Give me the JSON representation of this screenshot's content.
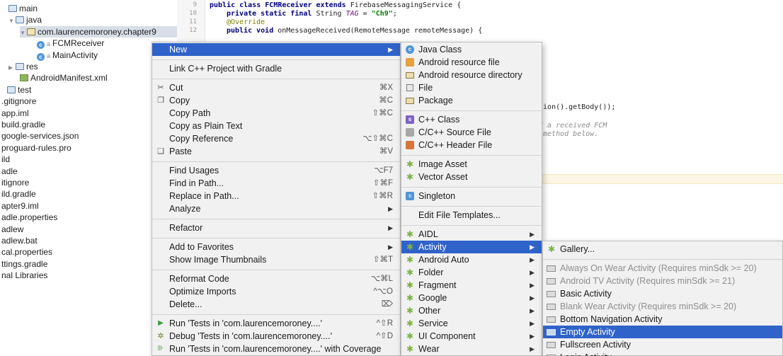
{
  "tree": {
    "items": [
      {
        "label": "main",
        "icon": "folder-icon",
        "indent": 12,
        "arrow": ""
      },
      {
        "label": "java",
        "icon": "folder-icon",
        "indent": 12,
        "arrow": "▼"
      },
      {
        "label": "com.laurencemoroney.chapter9",
        "icon": "package-icon",
        "indent": 28,
        "arrow": "▼",
        "selected": true
      },
      {
        "label": "FCMReceiver",
        "icon": "class-icon",
        "indent": 52,
        "arrow": ""
      },
      {
        "label": "MainActivity",
        "icon": "class-icon",
        "indent": 52,
        "arrow": ""
      },
      {
        "label": "res",
        "icon": "folder-icon",
        "indent": 12,
        "arrow": "▶"
      },
      {
        "label": "AndroidManifest.xml",
        "icon": "xml-icon",
        "indent": 28,
        "arrow": ""
      },
      {
        "label": "test",
        "icon": "folder-icon",
        "indent": 10,
        "arrow": ""
      },
      {
        "label": ".gitignore",
        "icon": "",
        "indent": 2,
        "arrow": ""
      },
      {
        "label": "app.iml",
        "icon": "",
        "indent": 2,
        "arrow": ""
      },
      {
        "label": "build.gradle",
        "icon": "",
        "indent": 2,
        "arrow": ""
      },
      {
        "label": "google-services.json",
        "icon": "",
        "indent": 2,
        "arrow": ""
      },
      {
        "label": "proguard-rules.pro",
        "icon": "",
        "indent": 2,
        "arrow": ""
      },
      {
        "label": "ild",
        "icon": "",
        "indent": 2,
        "arrow": ""
      },
      {
        "label": "adle",
        "icon": "",
        "indent": 2,
        "arrow": ""
      },
      {
        "label": "itignore",
        "icon": "",
        "indent": 2,
        "arrow": ""
      },
      {
        "label": "ild.gradle",
        "icon": "",
        "indent": 2,
        "arrow": ""
      },
      {
        "label": "apter9.iml",
        "icon": "",
        "indent": 2,
        "arrow": ""
      },
      {
        "label": "adle.properties",
        "icon": "",
        "indent": 2,
        "arrow": ""
      },
      {
        "label": "adlew",
        "icon": "",
        "indent": 2,
        "arrow": ""
      },
      {
        "label": "adlew.bat",
        "icon": "",
        "indent": 2,
        "arrow": ""
      },
      {
        "label": "cal.properties",
        "icon": "",
        "indent": 2,
        "arrow": ""
      },
      {
        "label": "ttings.gradle",
        "icon": "",
        "indent": 2,
        "arrow": ""
      },
      {
        "label": "nal Libraries",
        "icon": "",
        "indent": 2,
        "arrow": ""
      }
    ]
  },
  "editor": {
    "line_numbers": [
      "9",
      "10",
      "11",
      "12"
    ],
    "line1_kw": "public class ",
    "line1_name": "FCMReceiver ",
    "line1_kw2": "extends ",
    "line1_rest": "FirebaseMessagingService {",
    "line2_kw": "private static final ",
    "line2_type": "String ",
    "line2_var": "TAG",
    "line2_eq": " = ",
    "line2_str": "\"Ch9\"",
    "line2_end": ";",
    "line3": "@Override",
    "line4_kw": "public void ",
    "line4_rest": "onMessageReceived(RemoteMessage remoteMessage) {",
    "fragment1": "ation().getBody());",
    "fragment2": "of a received FCM",
    "fragment3": "n method below."
  },
  "menu1": {
    "items": [
      {
        "label": "New",
        "shortcut": "",
        "submenu": true,
        "active": true,
        "icon": ""
      },
      {
        "sep": true
      },
      {
        "label": "Link C++ Project with Gradle",
        "shortcut": "",
        "icon": ""
      },
      {
        "sep": true
      },
      {
        "label": "Cut",
        "shortcut": "⌘X",
        "icon": "scissors-icon"
      },
      {
        "label": "Copy",
        "shortcut": "⌘C",
        "icon": "copy-icon"
      },
      {
        "label": "Copy Path",
        "shortcut": "⇧⌘C",
        "icon": ""
      },
      {
        "label": "Copy as Plain Text",
        "shortcut": "",
        "icon": ""
      },
      {
        "label": "Copy Reference",
        "shortcut": "⌥⇧⌘C",
        "icon": ""
      },
      {
        "label": "Paste",
        "shortcut": "⌘V",
        "icon": "paste-icon"
      },
      {
        "sep": true
      },
      {
        "label": "Find Usages",
        "shortcut": "⌥F7",
        "icon": ""
      },
      {
        "label": "Find in Path...",
        "shortcut": "⇧⌘F",
        "icon": ""
      },
      {
        "label": "Replace in Path...",
        "shortcut": "⇧⌘R",
        "icon": ""
      },
      {
        "label": "Analyze",
        "shortcut": "",
        "submenu": true,
        "icon": ""
      },
      {
        "sep": true
      },
      {
        "label": "Refactor",
        "shortcut": "",
        "submenu": true,
        "icon": ""
      },
      {
        "sep": true
      },
      {
        "label": "Add to Favorites",
        "shortcut": "",
        "submenu": true,
        "icon": ""
      },
      {
        "label": "Show Image Thumbnails",
        "shortcut": "⇧⌘T",
        "icon": ""
      },
      {
        "sep": true
      },
      {
        "label": "Reformat Code",
        "shortcut": "⌥⌘L",
        "icon": ""
      },
      {
        "label": "Optimize Imports",
        "shortcut": "^⌥O",
        "icon": ""
      },
      {
        "label": "Delete...",
        "shortcut": "⌦",
        "icon": ""
      },
      {
        "sep": true
      },
      {
        "label": "Run 'Tests in 'com.laurencemoroney....'",
        "shortcut": "^⇧R",
        "icon": "run-icon"
      },
      {
        "label": "Debug 'Tests in 'com.laurencemoroney....'",
        "shortcut": "^⇧D",
        "icon": "debug-icon"
      },
      {
        "label": "Run 'Tests in 'com.laurencemoroney....' with Coverage",
        "shortcut": "",
        "icon": "coverage-icon"
      }
    ]
  },
  "menu2": {
    "items": [
      {
        "label": "Java Class",
        "icon": "java-class-icon"
      },
      {
        "label": "Android resource file",
        "icon": "android-resource-file-icon"
      },
      {
        "label": "Android resource directory",
        "icon": "folder-icon"
      },
      {
        "label": "File",
        "icon": "file-icon"
      },
      {
        "label": "Package",
        "icon": "package-icon"
      },
      {
        "sep": true
      },
      {
        "label": "C++ Class",
        "icon": "cpp-class-icon"
      },
      {
        "label": "C/C++ Source File",
        "icon": "cpp-source-icon"
      },
      {
        "label": "C/C++ Header File",
        "icon": "cpp-header-icon"
      },
      {
        "sep": true
      },
      {
        "label": "Image Asset",
        "icon": "android-icon"
      },
      {
        "label": "Vector Asset",
        "icon": "android-icon"
      },
      {
        "sep": true
      },
      {
        "label": "Singleton",
        "icon": "singleton-icon"
      },
      {
        "sep": true
      },
      {
        "label": "Edit File Templates...",
        "icon": ""
      },
      {
        "sep": true
      },
      {
        "label": "AIDL",
        "icon": "android-icon",
        "submenu": true
      },
      {
        "label": "Activity",
        "icon": "android-icon",
        "submenu": true,
        "active": true
      },
      {
        "label": "Android Auto",
        "icon": "android-icon",
        "submenu": true
      },
      {
        "label": "Folder",
        "icon": "android-icon",
        "submenu": true
      },
      {
        "label": "Fragment",
        "icon": "android-icon",
        "submenu": true
      },
      {
        "label": "Google",
        "icon": "android-icon",
        "submenu": true
      },
      {
        "label": "Other",
        "icon": "android-icon",
        "submenu": true
      },
      {
        "label": "Service",
        "icon": "android-icon",
        "submenu": true
      },
      {
        "label": "UI Component",
        "icon": "android-icon",
        "submenu": true
      },
      {
        "label": "Wear",
        "icon": "android-icon",
        "submenu": true
      }
    ]
  },
  "menu3": {
    "items": [
      {
        "label": "Gallery...",
        "icon": "android-icon"
      },
      {
        "sep": true
      },
      {
        "label": "Always On Wear Activity (Requires minSdk >= 20)",
        "icon": "template-icon",
        "disabled": true
      },
      {
        "label": "Android TV Activity (Requires minSdk >= 21)",
        "icon": "template-icon",
        "disabled": true
      },
      {
        "label": "Basic Activity",
        "icon": "template-icon"
      },
      {
        "label": "Blank Wear Activity (Requires minSdk >= 20)",
        "icon": "template-icon",
        "disabled": true
      },
      {
        "label": "Bottom Navigation Activity",
        "icon": "template-icon"
      },
      {
        "label": "Empty Activity",
        "icon": "template-icon",
        "active": true
      },
      {
        "label": "Fullscreen Activity",
        "icon": "template-icon"
      },
      {
        "label": "Login Activity",
        "icon": "template-icon"
      }
    ]
  },
  "colors": {
    "highlight": "#2f63c9",
    "menu_bg": "#f1f1f1",
    "android_green": "#7cb342"
  }
}
